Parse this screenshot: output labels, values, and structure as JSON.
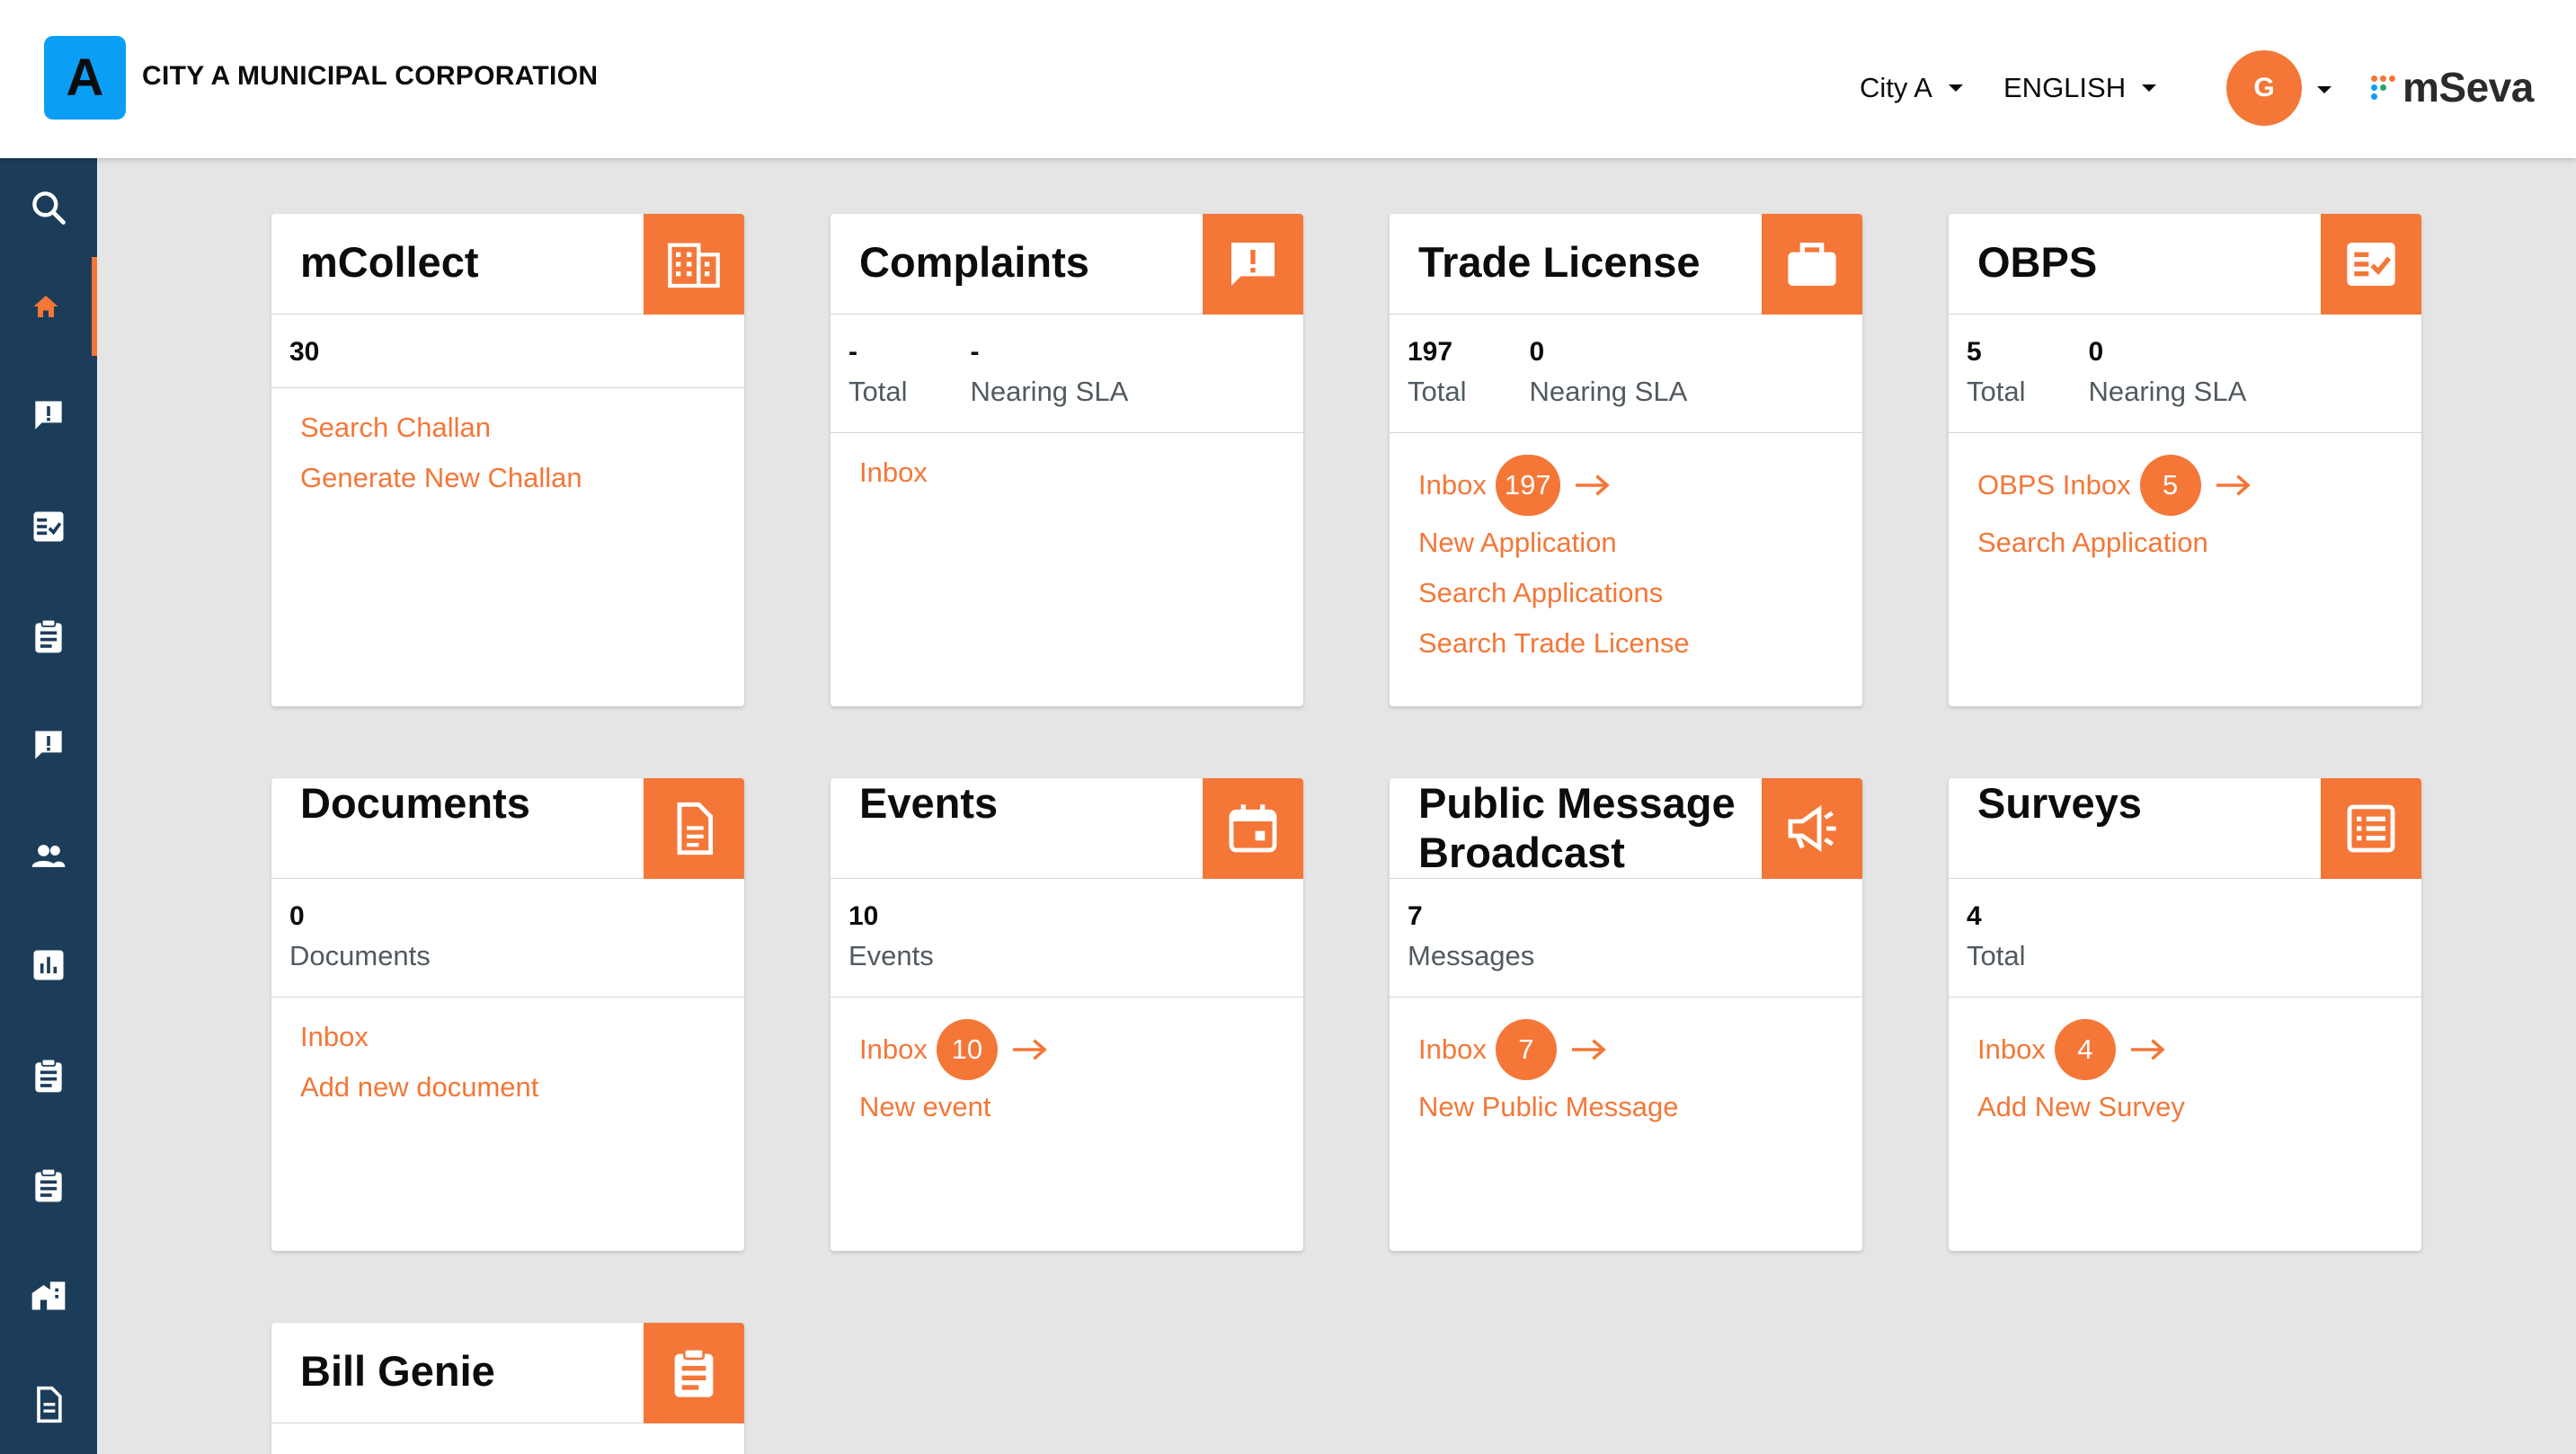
{
  "header": {
    "logo_letter": "A",
    "corporation": "CITY A MUNICIPAL CORPORATION",
    "city": "City A",
    "language": "ENGLISH",
    "avatar_initial": "G",
    "brand": "mSeva"
  },
  "colors": {
    "accent": "#f47738",
    "sidebar": "#1c3d5a",
    "logo_bg": "#0b9ef5",
    "link": "#f47738"
  },
  "sidebar": {
    "items": [
      {
        "icon": "search-icon"
      },
      {
        "icon": "home-icon",
        "active": true
      },
      {
        "icon": "complaint-icon"
      },
      {
        "icon": "checklist-icon"
      },
      {
        "icon": "clipboard-icon"
      },
      {
        "icon": "alert-message-icon"
      },
      {
        "icon": "people-icon"
      },
      {
        "icon": "bar-chart-icon"
      },
      {
        "icon": "clipboard-icon"
      },
      {
        "icon": "clipboard-icon"
      },
      {
        "icon": "building-icon"
      },
      {
        "icon": "document-icon"
      }
    ]
  },
  "cards": {
    "mcollect": {
      "title": "mCollect",
      "icon": "building-icon",
      "total": "30",
      "links": [
        "Search Challan",
        "Generate New Challan"
      ]
    },
    "complaints": {
      "title": "Complaints",
      "icon": "complaint-icon",
      "total": "-",
      "total_label": "Total",
      "sla": "-",
      "sla_label": "Nearing SLA",
      "links": [
        "Inbox"
      ]
    },
    "trade_license": {
      "title": "Trade License",
      "icon": "briefcase-icon",
      "total": "197",
      "total_label": "Total",
      "sla": "0",
      "sla_label": "Nearing SLA",
      "inbox_label": "Inbox",
      "inbox_count": "197",
      "links": [
        "New Application",
        "Search Applications",
        "Search Trade License"
      ]
    },
    "obps": {
      "title": "OBPS",
      "icon": "checklist-icon",
      "total": "5",
      "total_label": "Total",
      "sla": "0",
      "sla_label": "Nearing SLA",
      "inbox_label": "OBPS Inbox",
      "inbox_count": "5",
      "links": [
        "Search Application"
      ]
    },
    "documents": {
      "title": "Documents",
      "icon": "document-icon",
      "total": "0",
      "total_label": "Documents",
      "links": [
        "Inbox",
        "Add new document"
      ]
    },
    "events": {
      "title": "Events",
      "icon": "calendar-icon",
      "total": "10",
      "total_label": "Events",
      "inbox_label": "Inbox",
      "inbox_count": "10",
      "links": [
        "New event"
      ]
    },
    "broadcast": {
      "title": "Public Message Broadcast",
      "icon": "megaphone-icon",
      "total": "7",
      "total_label": "Messages",
      "inbox_label": "Inbox",
      "inbox_count": "7",
      "links": [
        "New Public Message"
      ]
    },
    "surveys": {
      "title": "Surveys",
      "icon": "list-icon",
      "total": "4",
      "total_label": "Total",
      "inbox_label": "Inbox",
      "inbox_count": "4",
      "links": [
        "Add New Survey"
      ]
    },
    "bill_genie": {
      "title": "Bill Genie",
      "icon": "clipboard-icon"
    }
  }
}
